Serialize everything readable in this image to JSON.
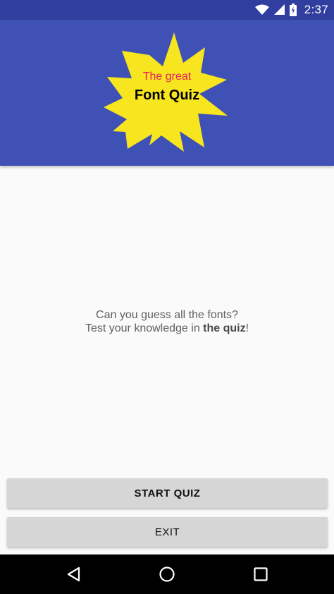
{
  "status_bar": {
    "time": "2:37",
    "icons": [
      "wifi-icon",
      "cell-signal-icon",
      "battery-icon"
    ]
  },
  "header": {
    "color": "#3f51b5",
    "logo": {
      "subtitle": "The great",
      "title": "Font Quiz",
      "star_color": "#f6e51f",
      "subtitle_color": "#e91e63"
    }
  },
  "main": {
    "line1": "Can you guess all the fonts?",
    "line2_prefix": "Test your knowledge in ",
    "line2_bold": "the quiz",
    "line2_suffix": "!"
  },
  "buttons": {
    "start": "START QUIZ",
    "exit": "EXIT"
  },
  "nav_bar": {
    "icons": [
      "back-icon",
      "home-icon",
      "recents-icon"
    ]
  }
}
